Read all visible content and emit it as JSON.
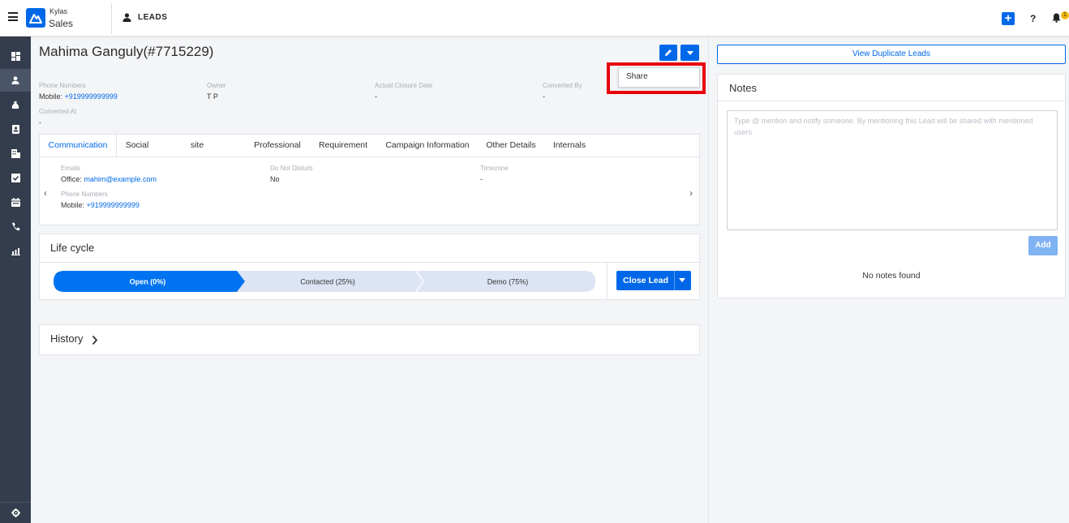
{
  "header": {
    "brand_top": "Kylas",
    "brand_bottom": "Sales",
    "module": "LEADS",
    "add_icon": "plus-icon",
    "help_label": "?",
    "notification_count": "1"
  },
  "sidebar": {
    "items": [
      "dashboard-icon",
      "leads-icon",
      "deals-icon",
      "contacts-icon",
      "companies-icon",
      "tasks-icon",
      "calendar-icon",
      "calls-icon",
      "reports-icon"
    ],
    "active_index": 1,
    "bottom": "settings-icon"
  },
  "lead": {
    "title": "Mahima Ganguly(#7715229)",
    "summary": {
      "phone_label": "Phone Numbers",
      "phone_prefix": "Mobile: ",
      "phone_value": "+919999999999",
      "owner_label": "Owner",
      "owner_value": "T P",
      "closure_label": "Actual Closure Date",
      "closure_value": "-",
      "converted_by_label": "Converted By",
      "converted_by_value": "-",
      "converted_at_label": "Converted At",
      "converted_at_value": "-"
    },
    "actions_menu": {
      "share": "Share"
    }
  },
  "tabs": {
    "items": [
      "Communication",
      "Social",
      "site",
      "Professional",
      "Requirement",
      "Campaign Information",
      "Other Details",
      "Internals"
    ],
    "active_index": 0,
    "communication": {
      "emails_label": "Emails",
      "email_prefix": "Office: ",
      "email_value": "mahim@example.com",
      "dnd_label": "Do Not Disturb",
      "dnd_value": "No",
      "timezone_label": "Timezone",
      "timezone_value": "-",
      "phone_label": "Phone Numbers",
      "phone_prefix": "Mobile: ",
      "phone_value": "+919999999999"
    }
  },
  "lifecycle": {
    "title": "Life cycle",
    "stages": [
      {
        "label": "Open (0%)",
        "active": true
      },
      {
        "label": "Contacted (25%)",
        "active": false
      },
      {
        "label": "Demo (75%)",
        "active": false
      }
    ],
    "close_label": "Close Lead"
  },
  "history": {
    "title": "History"
  },
  "notes": {
    "duplicate_label": "View Duplicate Leads",
    "title": "Notes",
    "placeholder": "Type @ mention and notify someone. By mentioning this Lead will be shared with mentioned users",
    "add_label": "Add",
    "empty_text": "No notes found"
  },
  "colors": {
    "primary": "#0068e8",
    "sidebar": "#333d4d",
    "highlight": "#e8000b",
    "stage_inactive": "#dde5f5"
  }
}
